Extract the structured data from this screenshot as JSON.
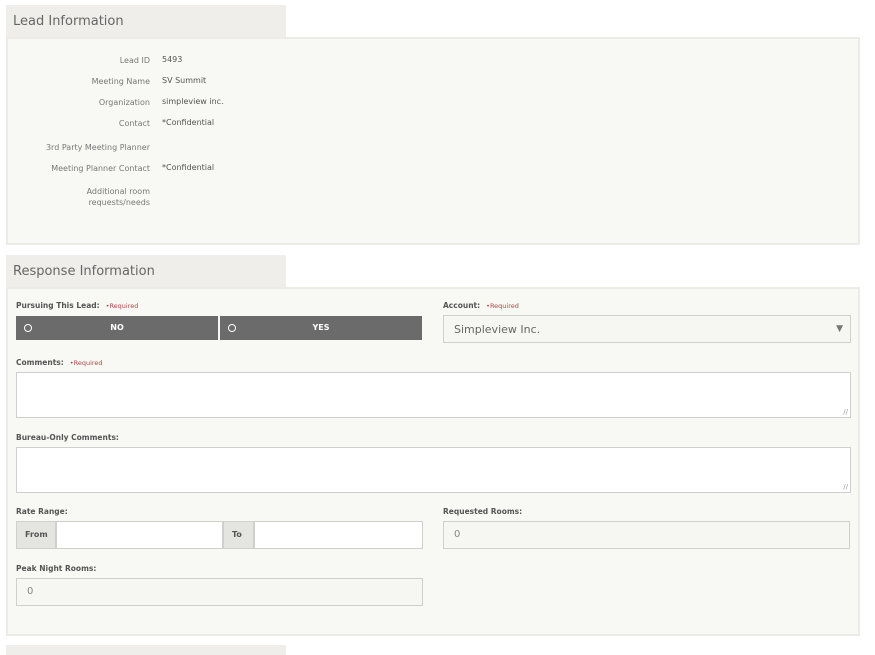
{
  "lead_section": {
    "title": "Lead Information",
    "rows": [
      {
        "label": "Lead ID",
        "value": "5493"
      },
      {
        "label": "Meeting Name",
        "value": "SV Summit"
      },
      {
        "label": "Organization",
        "value": "simpleview inc."
      },
      {
        "label": "Contact",
        "value": "*Confidential"
      },
      {
        "label": "3rd Party Meeting Planner",
        "value": ""
      },
      {
        "label": "Meeting Planner Contact",
        "value": "*Confidential"
      },
      {
        "label": "Additional room requests/needs",
        "value": ""
      }
    ]
  },
  "response_section": {
    "title": "Response Information",
    "required_text": "•Required",
    "pursuing": {
      "label": "Pursuing This Lead:",
      "options": [
        {
          "label": "NO",
          "selected": false
        },
        {
          "label": "YES",
          "selected": false
        }
      ]
    },
    "account": {
      "label": "Account:",
      "selected": "Simpleview Inc.",
      "arrow": "▼"
    },
    "comments": {
      "label": "Comments:",
      "value": ""
    },
    "bureau_comments": {
      "label": "Bureau-Only Comments:",
      "value": ""
    },
    "rate_range": {
      "label": "Rate Range:",
      "from_label": "From",
      "to_label": "To",
      "from_value": "",
      "to_value": ""
    },
    "requested_rooms": {
      "label": "Requested Rooms:",
      "value": "0"
    },
    "peak_night_rooms": {
      "label": "Peak Night Rooms:",
      "value": "0"
    }
  },
  "colors": {
    "toggle_bg": "#6b6b6b",
    "required": "#b04848",
    "panel_bg": "#f8f8f4",
    "tab_bg": "#efeeea"
  }
}
